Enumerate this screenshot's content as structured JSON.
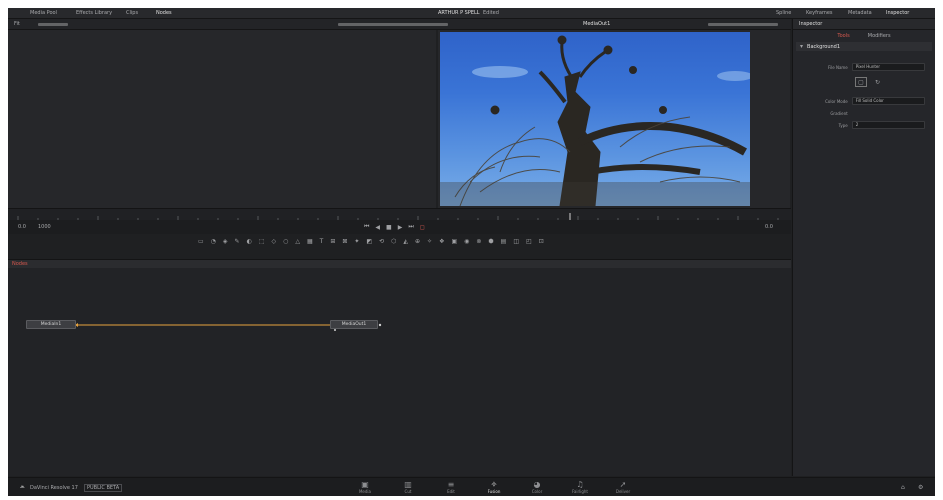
{
  "top_menu": {
    "left": [
      "Media Pool",
      "Effects Library",
      "Clips",
      "Nodes"
    ],
    "project_title": "ARTHUR P SPELL",
    "project_status": "Edited",
    "right": [
      "Spline",
      "Keyframes",
      "Metadata",
      "Inspector"
    ]
  },
  "viewer": {
    "clip_name": "MediaOut1",
    "zoom": "Fit"
  },
  "playback": {
    "start_frame": "0.0",
    "end_frame": "1000",
    "current_frame": "0.0"
  },
  "inspector": {
    "title": "Inspector",
    "tabs": [
      "Tools",
      "Modifiers"
    ],
    "node_name": "Background1",
    "fields": [
      {
        "label": "File Name",
        "value": "Pixel Hunter"
      },
      {
        "label": "Color Mode",
        "value": "Fill Solid Color"
      },
      {
        "label": "Gradient",
        "value": ""
      },
      {
        "label": "Type",
        "value": "2"
      }
    ]
  },
  "nodes_panel": {
    "title": "Nodes",
    "nodes": [
      "MediaIn1",
      "MediaOut1"
    ]
  },
  "bottom": {
    "app_name": "DaVinci Resolve 17",
    "badge": "PUBLIC BETA",
    "pages": [
      "Media",
      "Cut",
      "Edit",
      "Fusion",
      "Color",
      "Fairlight",
      "Deliver"
    ],
    "active_page": "Fusion",
    "page_icons": [
      "media-icon",
      "cut-icon",
      "edit-icon",
      "fusion-icon",
      "color-icon",
      "fairlight-icon",
      "deliver-icon"
    ]
  },
  "colors": {
    "accent": "#e8a33d",
    "background": "#1f2022",
    "node_header": "#c0392b"
  }
}
